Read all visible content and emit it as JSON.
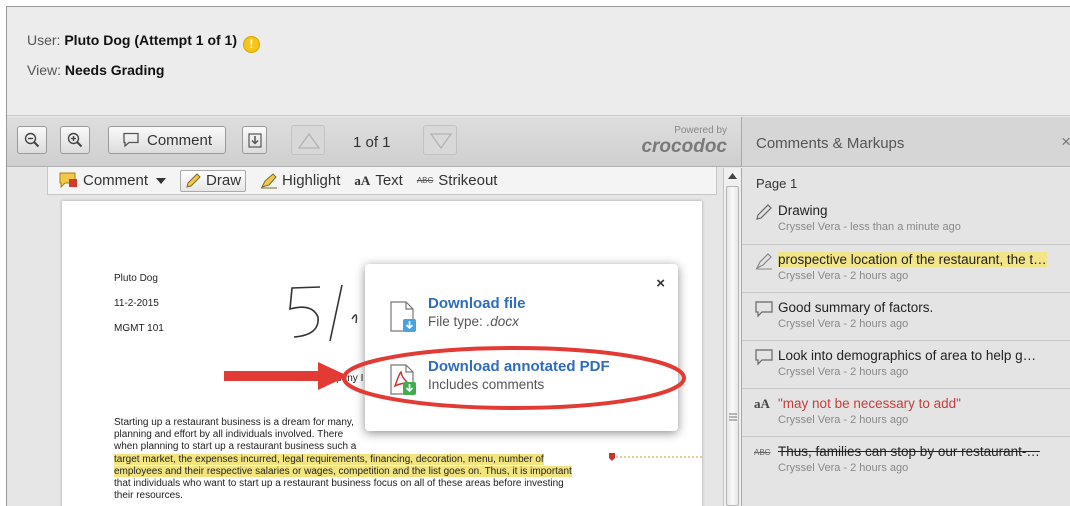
{
  "header": {
    "user_label": "User:",
    "user_value": "Pluto Dog (Attempt 1 of 1)",
    "view_label": "View:",
    "view_value": "Needs Grading",
    "warn_glyph": "!"
  },
  "toolbar": {
    "comment_label": "Comment",
    "page_info": "1 of 1",
    "powered_by": "Powered by",
    "brand": "crocodoc"
  },
  "annotation_tools": {
    "comment": "Comment",
    "draw": "Draw",
    "highlight": "Highlight",
    "text_icon": "aA",
    "text": "Text",
    "strike_icon": "ABC",
    "strikeout": "Strikeout"
  },
  "document": {
    "name": "Pluto Dog",
    "date": "11-2-2015",
    "course": "MGMT 101",
    "handwriting": "5/",
    "company_fragment": "Company I",
    "paragraph": [
      "Starting up a restaurant business is a dream for many,",
      "planning and effort by all individuals involved.  There",
      "when planning to start up a restaurant business such a",
      "target market, the expenses incurred, legal requirements, financing, decoration, menu, number of",
      "employees and their respective salaries or wages, competition and the list goes on.  Thus, it is important",
      "that individuals who want to start up a restaurant business focus on all of these areas before investing",
      "their resources."
    ]
  },
  "download_popup": {
    "close": "×",
    "file_title": "Download file",
    "file_sub_label": "File type:",
    "file_type": ".docx",
    "pdf_title": "Download annotated PDF",
    "pdf_sub": "Includes comments"
  },
  "comments_panel": {
    "title": "Comments & Markups",
    "close": "×",
    "page_label": "Page 1",
    "items": [
      {
        "type": "drawing",
        "text": "Drawing",
        "meta": "Cryssel Vera - less than a minute ago"
      },
      {
        "type": "highlight",
        "text": "prospective location of the restaurant, the t…",
        "meta": "Cryssel Vera - 2 hours ago"
      },
      {
        "type": "comment",
        "text": "Good summary of factors.",
        "meta": "Cryssel Vera - 2 hours ago"
      },
      {
        "type": "comment",
        "text": "Look into demographics of area to help g…",
        "meta": "Cryssel Vera - 2 hours ago"
      },
      {
        "type": "text",
        "text": "\"may not be necessary to add\"",
        "meta": "Cryssel Vera - 2 hours ago"
      },
      {
        "type": "strikeout",
        "text": "Thus, families can stop by our restaurant-…",
        "meta": "Cryssel Vera - 2 hours ago"
      }
    ]
  },
  "colors": {
    "link_blue": "#2f6cbb",
    "callout_red": "#e23b35",
    "highlight_yellow": "#f2e47e"
  }
}
